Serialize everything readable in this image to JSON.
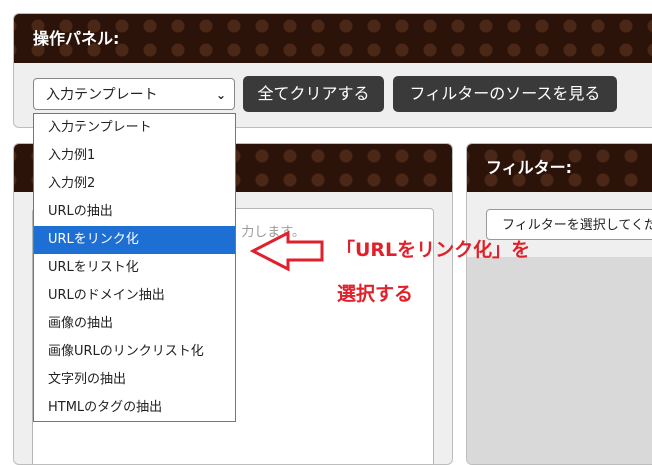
{
  "op_panel": {
    "title": "操作パネル:",
    "template_select": "入力テンプレート",
    "clear_button": "全てクリアする",
    "source_button": "フィルターのソースを見る"
  },
  "input_panel": {
    "placeholder_fragment": "力します。"
  },
  "filter_panel": {
    "title": "フィルター:",
    "filter_select": "フィルターを選択してください"
  },
  "dropdown": {
    "options": [
      "入力テンプレート",
      "入力例1",
      "入力例2",
      "URLの抽出",
      "URLをリンク化",
      "URLをリスト化",
      "URLのドメイン抽出",
      "画像の抽出",
      "画像URLのリンクリスト化",
      "文字列の抽出",
      "HTMLのタグの抽出"
    ],
    "selected": "URLをリンク化"
  },
  "annotation": {
    "line1": "「URLをリンク化」を",
    "line2": "選択する",
    "color": "#e0202a"
  },
  "colors": {
    "header_bg": "#2b1309",
    "selected_bg": "#1e6fd3"
  }
}
